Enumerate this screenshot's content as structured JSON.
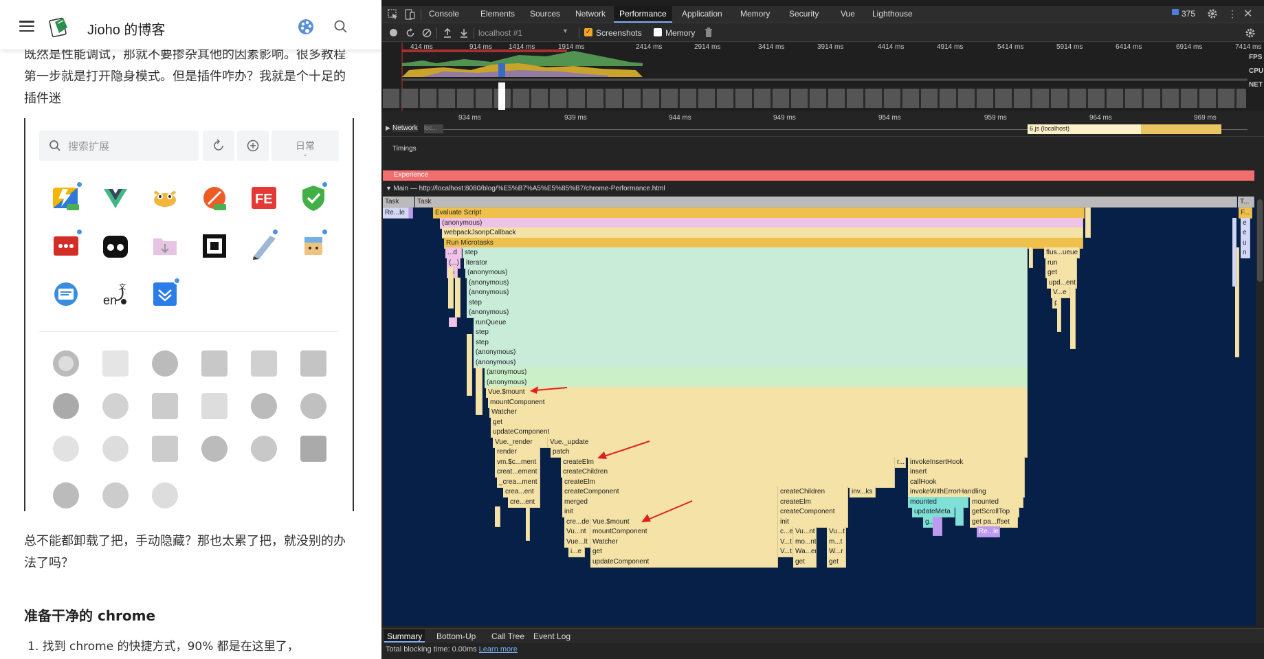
{
  "blog": {
    "title": "Jioho 的博客",
    "para1": "既然是性能调试，那就不要掺杂其他的因素影响。很多教程第一步就是打开隐身模式。但是插件咋办？我就是个十足的插件迷",
    "extension_panel": {
      "search_placeholder": "搜索扩展",
      "mode_label": "日常"
    },
    "para2": "总不能都卸载了把，手动隐藏？那也太累了把，就没别的办法了吗？",
    "heading": "准备干净的 chrome",
    "list_item_1": "1. 找到 chrome 的快捷方式，90% 都是在这里了，"
  },
  "devtools": {
    "tabs": [
      "Console",
      "Elements",
      "Sources",
      "Network",
      "Performance",
      "Application",
      "Memory",
      "Security",
      "Vue",
      "Lighthouse"
    ],
    "active_tab": "Performance",
    "issue_count": "375",
    "toolbar": {
      "profile_select": "localhost #1",
      "screenshots_label": "Screenshots",
      "memory_label": "Memory",
      "screenshots_checked": true,
      "memory_checked": false
    },
    "overview_ticks": [
      "414 ms",
      "914 ms",
      "1414 ms",
      "1914 ms",
      "2414 ms",
      "2914 ms",
      "3414 ms",
      "3914 ms",
      "4414 ms",
      "4914 ms",
      "5414 ms",
      "5914 ms",
      "6414 ms",
      "6914 ms",
      "7414 ms"
    ],
    "overview_labels": [
      "FPS",
      "CPU",
      "NET"
    ],
    "ruler_ticks": [
      "934 ms",
      "939 ms",
      "944 ms",
      "949 ms",
      "954 ms",
      "959 ms",
      "964 ms",
      "969 ms"
    ],
    "network_label": "Network",
    "network_badge": "loc...",
    "network_request": "6.js (localhost)",
    "timings_label": "Timings",
    "experience_label": "Experience",
    "main_label": "Main — http://localhost:8080/blog/%E5%B7%A5%E5%85%B7/chrome-Performance.html",
    "bottom_tabs": [
      "Summary",
      "Bottom-Up",
      "Call Tree",
      "Event Log"
    ],
    "active_bottom_tab": "Summary",
    "blocking_time": "Total blocking time: 0.00ms",
    "learn_more": "Learn more"
  },
  "colors": {
    "flame_scripting": "#f4e2a6",
    "flame_green": "#c8ecd8",
    "flame_pink": "#efc2e8",
    "flame_yellow": "#efc14c",
    "experience": "#f06e6e",
    "annotation_arrow": "#e02020"
  },
  "flame": {
    "task1": "Task",
    "task2": "Task",
    "task3": "T...",
    "r1": "Re...le",
    "evaluate": "Evaluate Script",
    "anon0": "(anonymous)",
    "webpack": "webpackJsonpCallback",
    "microtasks": "Run Microtasks",
    "step1": "step",
    "iterator": "iterator",
    "anon1": "(anonymous)",
    "anon2": "(anonymous)",
    "anon3": "(anonymous)",
    "step2": "step",
    "anon4": "(anonymous)",
    "runqueue": "runQueue",
    "step3": "step",
    "step4": "step",
    "anon5": "(anonymous)",
    "anon6": "(anonymous)",
    "anon7": "(anonymous)",
    "anon8": "(anonymous)",
    "vuemount": "Vue.$mount",
    "mountcomp": "mountComponent",
    "watcher": "Watcher",
    "get": "get",
    "updatecomp": "updateComponent",
    "vuerender": "Vue._render",
    "vueupdate": "Vue._update",
    "render": "render",
    "patch": "patch",
    "vmc": "vm.$c...ment",
    "createelm": "createElm",
    "creatEl": "creat...ement",
    "createchildren": "createChildren",
    "crea1": "_crea...ment",
    "createelm2": "createElm",
    "crea2": "crea...ent",
    "createcomponent": "createComponent",
    "createchildren2": "createChildren",
    "invks": "inv...ks",
    "cre": "cre...ent",
    "merged": "merged",
    "createelm3": "createElm",
    "init": "init",
    "createcomp2": "createComponent",
    "crede": "cre...de",
    "vuemount2": "Vue.$mount",
    "init2": "init",
    "vunt": "Vu...nt",
    "mountcomp2": "mountComponent",
    "vut": "Vue...lt",
    "watcher2": "Watcher",
    "ie": "i...e",
    "get2": "get",
    "updatecomp2": "updateComponent",
    "ce": "c...e",
    "vunt2": "Vu...nt",
    "vut2": "Vu...t",
    "vt": "V...t",
    "mont": "mo...nt",
    "mt": "m...t",
    "vt2": "V...t",
    "wa": "Wa...er",
    "wr": "W...r",
    "get3": "get",
    "get4": "get",
    "r2": "r...",
    "invokeinsert": "invokeInsertHook",
    "insert": "insert",
    "callhook": "callHook",
    "invokewitherr": "invokeWithErrorHandling",
    "mounted": "mounted",
    "mounted2": "mounted",
    "updatemeta": "updateMeta",
    "getscrolltop": "getScrollTop",
    "g": "g...",
    "getpa": "get pa...ffset",
    "re": "Re...le",
    "flushq": "flus...ueue",
    "run": "run",
    "get5": "get",
    "upd": "upd...ent",
    "ve": "V...e",
    "p": "p...",
    "f": "F...",
    "e1": "e",
    "e2": "e",
    "u": "u",
    "n": "n",
    "d": "...d",
    "paren": "(...)",
    "fn": "fn"
  }
}
